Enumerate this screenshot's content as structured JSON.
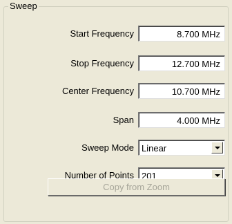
{
  "sweep": {
    "title": "Sweep",
    "start_frequency": {
      "label": "Start Frequency",
      "value": "8.700 MHz"
    },
    "stop_frequency": {
      "label": "Stop Frequency",
      "value": "12.700 MHz"
    },
    "center_frequency": {
      "label": "Center Frequency",
      "value": "10.700 MHz"
    },
    "span": {
      "label": "Span",
      "value": "4.000 MHz"
    },
    "sweep_mode": {
      "label": "Sweep Mode",
      "value": "Linear"
    },
    "number_of_points": {
      "label": "Number of Points",
      "value": "201"
    },
    "copy_button": {
      "label": "Copy from Zoom",
      "enabled": false
    }
  }
}
